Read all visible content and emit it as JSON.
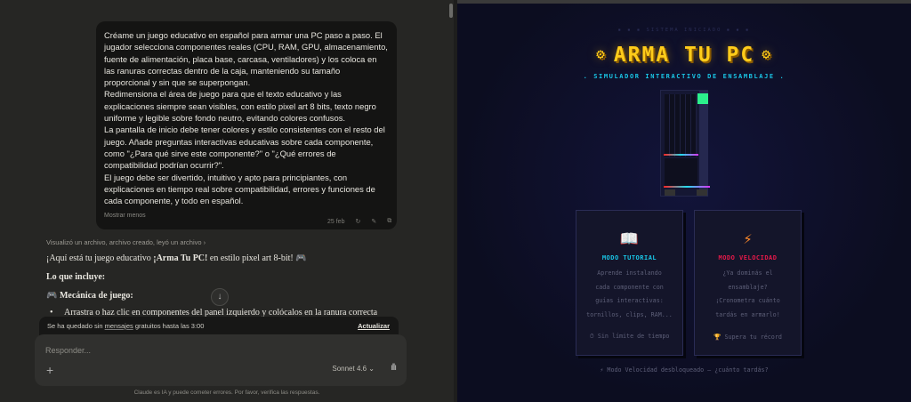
{
  "chat": {
    "user_message": "Créame un juego educativo en español para armar una PC paso a paso. El jugador selecciona componentes reales (CPU, RAM, GPU, almacenamiento, fuente de alimentación, placa base, carcasa, ventiladores) y los coloca en las ranuras correctas dentro de la caja, manteniendo su tamaño proporcional y sin que se superpongan.\nRedimensiona el área de juego para que el texto educativo y las explicaciones siempre sean visibles, con estilo pixel art 8 bits, texto negro uniforme y legible sobre fondo neutro, evitando colores confusos.\nLa pantalla de inicio debe tener colores y estilo consistentes con el resto del juego. Añade preguntas interactivas educativas sobre cada componente, como \"¿Para qué sirve este componente?\" o \"¿Qué errores de compatibilidad podrían ocurrir?\".\nEl juego debe ser divertido, intuitivo y apto para principiantes, con explicaciones en tiempo real sobre compatibilidad, errores y funciones de cada componente, y todo en español.",
    "show_less": "Mostrar menos",
    "date": "25 feb",
    "activity": "Visualizó un archivo, archivo creado, leyó un archivo ›",
    "resp_intro_a": "¡Aquí está tu juego educativo ",
    "resp_intro_b": "¡Arma Tu PC!",
    "resp_intro_c": " en estilo pixel art 8-bit! 🎮",
    "resp_includes": "Lo que incluye:",
    "resp_mechanic": "🎮 Mecánica de juego:",
    "resp_bullet": "Arrastra o haz clic en componentes del panel izquierdo y colócalos en la ranura correcta",
    "limit_a": "Se ha quedado sin ",
    "limit_b": "mensajes",
    "limit_c": " gratuitos hasta las 3:00",
    "upgrade": "Actualizar",
    "placeholder": "Responder...",
    "model": "Sonnet 4.6 ⌄",
    "footer": "Claude es IA y puede cometer errores. Por favor, verifica las respuestas."
  },
  "game": {
    "system": "▪ ▪ ▪ SISTEMA INICIADO ▪ ▪ ▪",
    "title": "ARMA TU PC",
    "subtitle": ". SIMULADOR INTERACTIVO DE ENSAMBLAJE .",
    "tutorial": {
      "icon": "📖",
      "title": "MODO TUTORIAL",
      "desc": "Aprende instalando\ncada componente con\nguías interactivas:\ntornillos, clips, RAM...",
      "foot": "⏱ Sin límite de tiempo",
      "color": "#19c6e6"
    },
    "speed": {
      "icon": "⚡",
      "title": "MODO VELOCIDAD",
      "desc": "¿Ya dominás el\nensamblaje?\n¡Cronometra cuánto\ntardás en armarlo!",
      "foot": "🏆 Supera tu récord",
      "color": "#e8194a"
    },
    "unlock": "⚡  Modo Velocidad desbloqueado — ¿cuánto tardás?"
  }
}
